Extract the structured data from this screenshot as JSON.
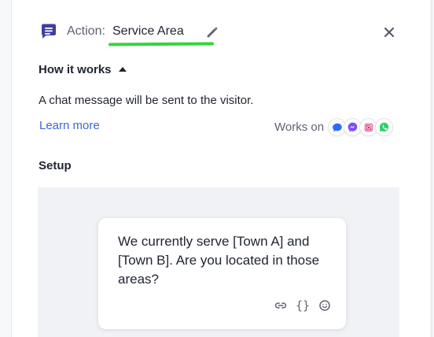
{
  "header": {
    "action_prefix": "Action:",
    "action_name": "Service Area",
    "icons": {
      "action": "chat-action-icon",
      "edit": "pencil-icon",
      "close": "close-icon"
    }
  },
  "how_it_works": {
    "title": "How it works",
    "toggle_icon": "triangle-up-icon",
    "description": "A chat message will be sent to the visitor.",
    "learn_more": "Learn more",
    "works_on_label": "Works on",
    "channels": [
      {
        "name": "chat",
        "icon": "chat-bubble-icon",
        "color": "#2d6cff"
      },
      {
        "name": "messenger",
        "icon": "messenger-icon",
        "color": "#8a4dff"
      },
      {
        "name": "instagram",
        "icon": "instagram-icon",
        "color": "#e4405f"
      },
      {
        "name": "whatsapp",
        "icon": "whatsapp-icon",
        "color": "#25d366"
      }
    ]
  },
  "setup": {
    "title": "Setup",
    "message": "We currently serve [Town A] and [Town B]. Are you located in those areas?",
    "tools": [
      {
        "name": "link-icon"
      },
      {
        "name": "variable-braces-icon",
        "glyph": "{}"
      },
      {
        "name": "emoji-icon"
      }
    ]
  },
  "colors": {
    "accent": "#3a67d8",
    "action_icon": "#3f3f9f",
    "highlight": "#32d63a"
  }
}
